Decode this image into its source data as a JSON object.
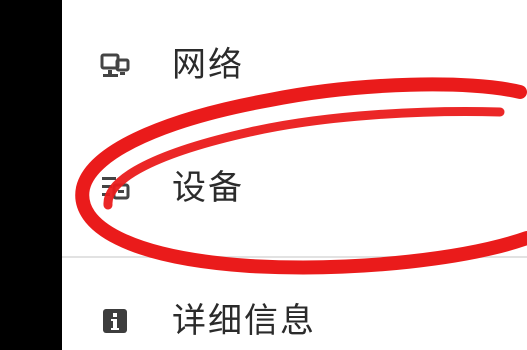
{
  "menu": {
    "items": [
      {
        "id": "network",
        "label": "网络",
        "icon": "network-icon"
      },
      {
        "id": "devices",
        "label": "设备",
        "icon": "devices-icon"
      },
      {
        "id": "details",
        "label": "详细信息",
        "icon": "info-icon"
      }
    ]
  },
  "annotation": {
    "shape": "ellipse",
    "color": "#ea1b1b",
    "target": "设备"
  }
}
